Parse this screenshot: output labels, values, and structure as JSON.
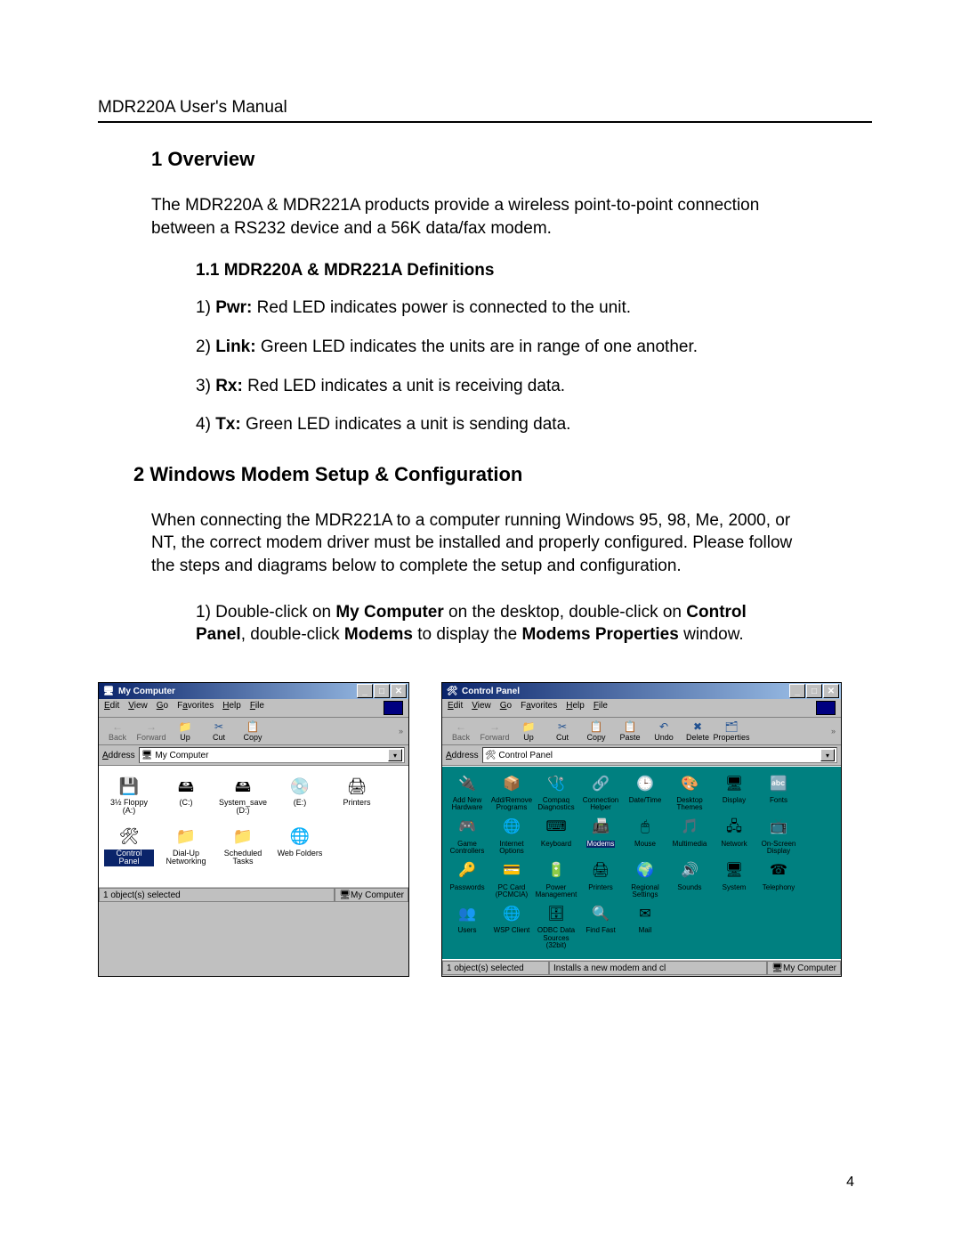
{
  "page": {
    "running_head": "MDR220A User's Manual",
    "page_number": "4"
  },
  "section1": {
    "heading": "1 Overview",
    "intro": "The MDR220A & MDR221A products provide a wireless point-to-point connection between a RS232 device and a 56K data/fax modem.",
    "sub_heading": "1.1  MDR220A & MDR221A Definitions",
    "defs": [
      {
        "n": "1)",
        "term": "Pwr:",
        "desc": "  Red LED indicates power is connected to the unit."
      },
      {
        "n": "2)",
        "term": "Link:",
        "desc": "  Green LED indicates the units are in range of one another."
      },
      {
        "n": "3)",
        "term": "Rx:",
        "desc": "  Red LED indicates a unit is receiving data."
      },
      {
        "n": "4)",
        "term": "Tx:",
        "desc": "  Green LED indicates a unit is sending data."
      }
    ]
  },
  "section2": {
    "heading": "2 Windows Modem Setup & Configuration",
    "intro": "When connecting the MDR221A to a computer running Windows 95, 98, Me, 2000, or NT, the correct modem driver must be installed and properly configured.  Please follow the steps and diagrams below to complete the setup and configuration.",
    "step1": {
      "n": "1)",
      "pre": "  Double-click on ",
      "b1": "My Computer",
      "mid1": " on the desktop, double-click on ",
      "b2": "Control Panel",
      "mid2": ", double-click ",
      "b3": "Modems",
      "mid3": " to display the ",
      "b4": "Modems Properties",
      "post": " window."
    }
  },
  "win_left": {
    "title": "My Computer",
    "menu": [
      "File",
      "Edit",
      "View",
      "Go",
      "Favorites",
      "Help"
    ],
    "menu_underline_index": [
      0,
      0,
      0,
      0,
      1,
      0
    ],
    "toolbar": [
      {
        "name": "back",
        "label": "Back",
        "glyph": "←",
        "disabled": true
      },
      {
        "name": "forward",
        "label": "Forward",
        "glyph": "→",
        "disabled": true
      },
      {
        "name": "up",
        "label": "Up",
        "glyph": "📁",
        "disabled": false
      },
      {
        "name": "cut",
        "label": "Cut",
        "glyph": "✂",
        "disabled": false
      },
      {
        "name": "copy",
        "label": "Copy",
        "glyph": "📋",
        "disabled": false
      }
    ],
    "address_label": "Address",
    "address_value": "My Computer",
    "icons_row1": [
      {
        "name": "floppy",
        "label": "3½ Floppy (A:)",
        "glyph": "💾"
      },
      {
        "name": "drive-c",
        "label": "(C:)",
        "glyph": "🖴"
      },
      {
        "name": "drive-d",
        "label": "System_save (D:)",
        "glyph": "🖴"
      },
      {
        "name": "drive-e",
        "label": "(E:)",
        "glyph": "💿"
      },
      {
        "name": "printers",
        "label": "Printers",
        "glyph": "🖨"
      }
    ],
    "icons_row2": [
      {
        "name": "control-panel",
        "label": "Control Panel",
        "glyph": "🛠",
        "selected": true
      },
      {
        "name": "dialup",
        "label": "Dial-Up Networking",
        "glyph": "📁"
      },
      {
        "name": "scheduled",
        "label": "Scheduled Tasks",
        "glyph": "📁"
      },
      {
        "name": "web-folders",
        "label": "Web Folders",
        "glyph": "🌐"
      }
    ],
    "status_left": "1 object(s) selected",
    "status_right_icon": "🖥",
    "status_right": "My Computer"
  },
  "win_right": {
    "title": "Control Panel",
    "menu": [
      "File",
      "Edit",
      "View",
      "Go",
      "Favorites",
      "Help"
    ],
    "menu_underline_index": [
      0,
      0,
      0,
      0,
      1,
      0
    ],
    "toolbar": [
      {
        "name": "back",
        "label": "Back",
        "glyph": "←",
        "disabled": true
      },
      {
        "name": "forward",
        "label": "Forward",
        "glyph": "→",
        "disabled": true
      },
      {
        "name": "up",
        "label": "Up",
        "glyph": "📁",
        "disabled": false
      },
      {
        "name": "cut",
        "label": "Cut",
        "glyph": "✂",
        "disabled": false
      },
      {
        "name": "copy",
        "label": "Copy",
        "glyph": "📋",
        "disabled": false
      },
      {
        "name": "paste",
        "label": "Paste",
        "glyph": "📋",
        "disabled": false
      },
      {
        "name": "undo",
        "label": "Undo",
        "glyph": "↶",
        "disabled": false
      },
      {
        "name": "delete",
        "label": "Delete",
        "glyph": "✖",
        "disabled": false
      },
      {
        "name": "properties",
        "label": "Properties",
        "glyph": "🗂",
        "disabled": false
      }
    ],
    "address_label": "Address",
    "address_value": "Control Panel",
    "icons": [
      {
        "name": "add-hw",
        "label": "Add New Hardware",
        "glyph": "🔌"
      },
      {
        "name": "add-remove",
        "label": "Add/Remove Programs",
        "glyph": "📦"
      },
      {
        "name": "compaq",
        "label": "Compaq Diagnostics",
        "glyph": "🩺"
      },
      {
        "name": "connection",
        "label": "Connection Helper",
        "glyph": "🔗"
      },
      {
        "name": "datetime",
        "label": "Date/Time",
        "glyph": "🕒"
      },
      {
        "name": "themes",
        "label": "Desktop Themes",
        "glyph": "🎨"
      },
      {
        "name": "display",
        "label": "Display",
        "glyph": "🖥"
      },
      {
        "name": "fonts",
        "label": "Fonts",
        "glyph": "🔤"
      },
      {
        "name": "game",
        "label": "Game Controllers",
        "glyph": "🎮"
      },
      {
        "name": "internet",
        "label": "Internet Options",
        "glyph": "🌐"
      },
      {
        "name": "keyboard",
        "label": "Keyboard",
        "glyph": "⌨"
      },
      {
        "name": "modems",
        "label": "Modems",
        "glyph": "📠",
        "selected": true
      },
      {
        "name": "mouse",
        "label": "Mouse",
        "glyph": "🖱"
      },
      {
        "name": "multimedia",
        "label": "Multimedia",
        "glyph": "🎵"
      },
      {
        "name": "network",
        "label": "Network",
        "glyph": "🖧"
      },
      {
        "name": "onscreen",
        "label": "On-Screen Display",
        "glyph": "📺"
      },
      {
        "name": "passwords",
        "label": "Passwords",
        "glyph": "🔑"
      },
      {
        "name": "pccard",
        "label": "PC Card (PCMCIA)",
        "glyph": "💳"
      },
      {
        "name": "power",
        "label": "Power Management",
        "glyph": "🔋"
      },
      {
        "name": "printers",
        "label": "Printers",
        "glyph": "🖨"
      },
      {
        "name": "regional",
        "label": "Regional Settings",
        "glyph": "🌍"
      },
      {
        "name": "sounds",
        "label": "Sounds",
        "glyph": "🔊"
      },
      {
        "name": "system",
        "label": "System",
        "glyph": "🖥"
      },
      {
        "name": "telephony",
        "label": "Telephony",
        "glyph": "☎"
      },
      {
        "name": "users",
        "label": "Users",
        "glyph": "👥"
      },
      {
        "name": "wsp",
        "label": "WSP Client",
        "glyph": "🌐"
      },
      {
        "name": "odbc",
        "label": "ODBC Data Sources (32bit)",
        "glyph": "🗄"
      },
      {
        "name": "findfast",
        "label": "Find Fast",
        "glyph": "🔍"
      },
      {
        "name": "mail",
        "label": "Mail",
        "glyph": "✉"
      }
    ],
    "status_left": "1 object(s) selected",
    "status_mid": "Installs a new modem and cl",
    "status_right_icon": "🖥",
    "status_right": "My Computer"
  }
}
